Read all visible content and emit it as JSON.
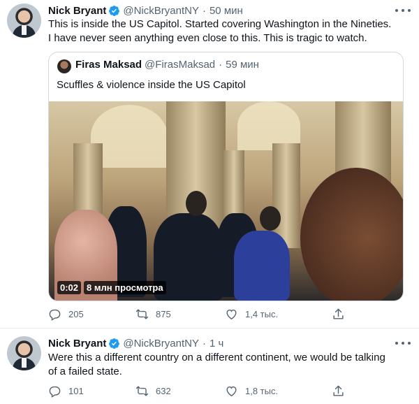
{
  "tweets": [
    {
      "author": {
        "name": "Nick Bryant",
        "handle": "@NickBryantNY",
        "verified": true
      },
      "separator": "·",
      "time": "50 мин",
      "text_lines": [
        "This is inside the US Capitol. Started covering Washington in the Nineties.",
        "I have never seen anything even close to this. This is tragic to watch."
      ],
      "quote": {
        "author": {
          "name": "Firas Maksad",
          "handle": "@FirasMaksad"
        },
        "separator": "·",
        "time": "59 мин",
        "text": "Scuffles & violence inside the US Capitol",
        "video": {
          "duration": "0:02",
          "views": "8 млн просмотра"
        }
      },
      "actions": {
        "replies": "205",
        "retweets": "875",
        "likes": "1,4 тыс."
      }
    },
    {
      "author": {
        "name": "Nick Bryant",
        "handle": "@NickBryantNY",
        "verified": true
      },
      "separator": "·",
      "time": "1 ч",
      "text_lines": [
        "Were this a different country on a different continent, we would be talking",
        "of a failed state."
      ],
      "actions": {
        "replies": "101",
        "retweets": "632",
        "likes": "1,8 тыс."
      }
    }
  ],
  "icons": {
    "verified": "verified-badge-icon",
    "more": "more-options-icon",
    "reply": "reply-icon",
    "retweet": "retweet-icon",
    "like": "like-icon",
    "share": "share-icon"
  },
  "colors": {
    "verified": "#1d9bf0",
    "secondary_text": "#536471",
    "border": "#cfd9de"
  }
}
